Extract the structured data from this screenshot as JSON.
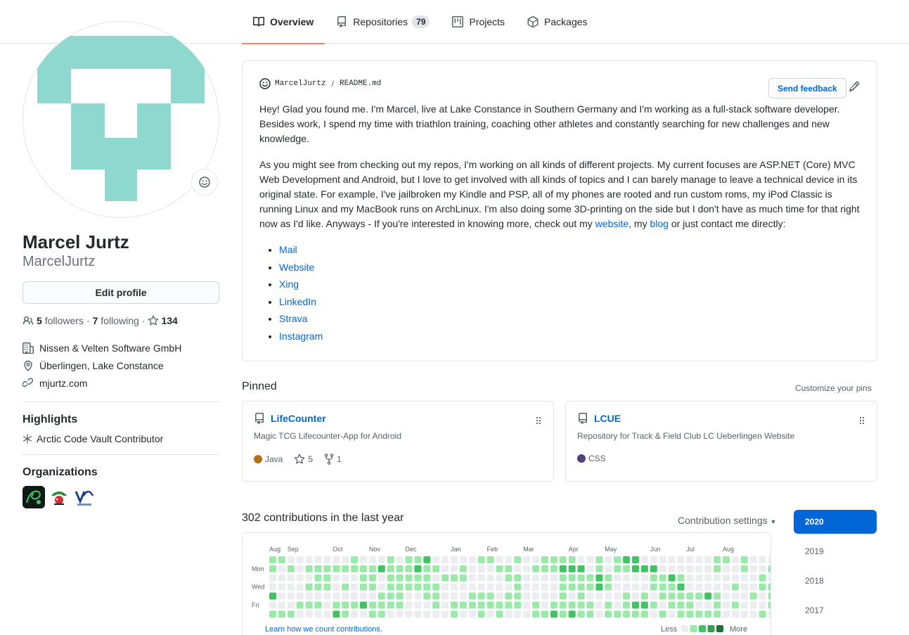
{
  "tabs": [
    {
      "label": "Overview",
      "icon": "book-icon"
    },
    {
      "label": "Repositories",
      "icon": "repo-icon",
      "count": "79"
    },
    {
      "label": "Projects",
      "icon": "project-icon"
    },
    {
      "label": "Packages",
      "icon": "package-icon"
    }
  ],
  "profile": {
    "name": "Marcel Jurtz",
    "login": "MarcelJurtz",
    "edit_label": "Edit profile",
    "followers_count": "5",
    "followers_label": "followers",
    "dot": "·",
    "following_count": "7",
    "following_label": "following",
    "stars": "134",
    "company": "Nissen & Velten Software GmbH",
    "location": "Überlingen, Lake Constance",
    "website": "mjurtz.com"
  },
  "highlights": {
    "title": "Highlights",
    "item": "Arctic Code Vault Contributor"
  },
  "organizations": {
    "title": "Organizations"
  },
  "readme": {
    "user": "MarcelJurtz",
    "separator": "/",
    "file": "README.md",
    "feedback_label": "Send feedback",
    "p1": "Hey! Glad you found me. I'm Marcel, live at Lake Constance in Southern Germany and I'm working as a full-stack software developer. Besides work, I spend my time with triathlon training, coaching other athletes and constantly searching for new challenges and new knowledge.",
    "p2_start": "As you might see from checking out my repos, I'm working on all kinds of different projects. My current focuses are ASP.NET (Core) MVC Web Development and Android, but I love to get involved with all kinds of topics and I can barely manage to leave a technical device in its original state. For example, I've jailbroken my Kindle and PSP, all of my phones are rooted and run custom roms, my iPod Classic is running Linux and my MacBook runs on ArchLinux. I'm also doing some 3D-printing on the side but I don't have as much time for that right now as I'd like. Anyways - If you're interested in knowing more, check out my ",
    "link_website": "website",
    "p2_mid": ", my ",
    "link_blog": "blog",
    "p2_end": " or just contact me directly:",
    "links": [
      "Mail",
      "Website",
      "Xing",
      "LinkedIn",
      "Strava",
      "Instagram"
    ]
  },
  "pinned": {
    "title": "Pinned",
    "customize": "Customize your pins",
    "repos": [
      {
        "name": "LifeCounter",
        "desc": "Magic TCG Lifecounter-App for Android",
        "lang": "Java",
        "lang_color": "#b07219",
        "stars": "5",
        "forks": "1"
      },
      {
        "name": "LCUE",
        "desc": "Repository for Track & Field Club LC Ueberlingen Website",
        "lang": "CSS",
        "lang_color": "#563d7c"
      }
    ]
  },
  "contributions": {
    "title": "302 contributions in the last year",
    "settings": "Contribution settings",
    "months": [
      "Aug",
      "Sep",
      "Oct",
      "Nov",
      "Dec",
      "Jan",
      "Feb",
      "Mar",
      "Apr",
      "May",
      "Jun",
      "Jul",
      "Aug"
    ],
    "days": [
      "Mon",
      "Wed",
      "Fri"
    ],
    "learn": "Learn how we count contributions.",
    "less": "Less",
    "more": "More",
    "level_colors": [
      "#ebedf0",
      "#9be9a8",
      "#40c463",
      "#30a14e",
      "#216e39"
    ],
    "levels": [
      "1100000001000101120000011001001111001012200000000110100011000",
      "1010111111112111211001000110011122201011222000000100100100110",
      "0000011000110111110111000011000011112100001121000000001001101",
      "0000111010110111111000000001000011112100001112000001001101101",
      "2000000000001110011000111011000010100001010111112100010101001",
      "0001110111211110001011111111010111110101221011100101000100110",
      "1110000210011000000010010100011212110111110101111100001010101"
    ],
    "years": [
      "2020",
      "2019",
      "2018",
      "2017"
    ]
  }
}
